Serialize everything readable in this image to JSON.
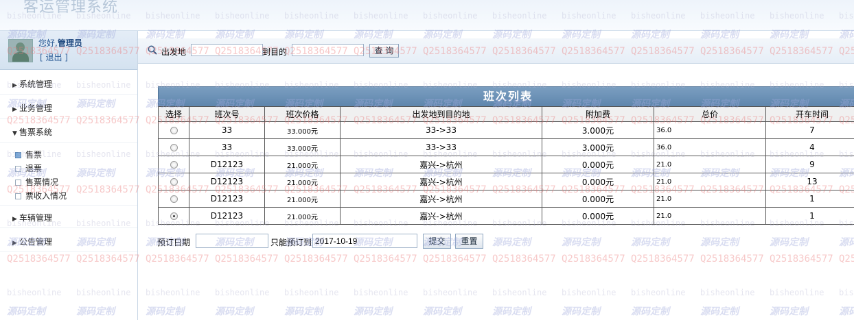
{
  "header": {
    "title": "客运管理系统"
  },
  "user": {
    "greeting": "您好,",
    "name": "管理员",
    "logout": "[ 退出 ]"
  },
  "menu": {
    "system": "系统管理",
    "business": "业务管理",
    "ticketing": "售票系统",
    "sub": [
      "售票",
      "退票",
      "售票情况",
      "票收入情况"
    ],
    "vehicle": "车辆管理",
    "notice": "公告管理"
  },
  "search": {
    "from_label": "出发地",
    "to_label": "到目的",
    "from_value": "",
    "to_value": "",
    "button": "查 询"
  },
  "table": {
    "caption": "班次列表",
    "headers": [
      "选择",
      "班次号",
      "班次价格",
      "出发地到目的地",
      "附加费",
      "总价",
      "开车时间"
    ],
    "rows": [
      {
        "id": "33",
        "price": "33.000元",
        "route": "33->33",
        "fee": "3.000元",
        "total": "36.0",
        "time": "7",
        "selected": false
      },
      {
        "id": "33",
        "price": "33.000元",
        "route": "33->33",
        "fee": "3.000元",
        "total": "36.0",
        "time": "4",
        "selected": false
      },
      {
        "id": "D12123",
        "price": "21.000元",
        "route": "嘉兴->杭州",
        "fee": "0.000元",
        "total": "21.0",
        "time": "9",
        "selected": false
      },
      {
        "id": "D12123",
        "price": "21.000元",
        "route": "嘉兴->杭州",
        "fee": "0.000元",
        "total": "21.0",
        "time": "13",
        "selected": false
      },
      {
        "id": "D12123",
        "price": "21.000元",
        "route": "嘉兴->杭州",
        "fee": "0.000元",
        "total": "21.0",
        "time": "1",
        "selected": false
      },
      {
        "id": "D12123",
        "price": "21.000元",
        "route": "嘉兴->杭州",
        "fee": "0.000元",
        "total": "21.0",
        "time": "1",
        "selected": true
      }
    ]
  },
  "booking": {
    "date_label": "预订日期",
    "date_value": "",
    "limit_label": "只能预订到",
    "limit_value": "2017-10-19",
    "submit": "提交",
    "reset": "重置"
  },
  "watermark": {
    "line1": "bisheonline",
    "line2": "源码定制",
    "line3": "Q2518364577"
  }
}
